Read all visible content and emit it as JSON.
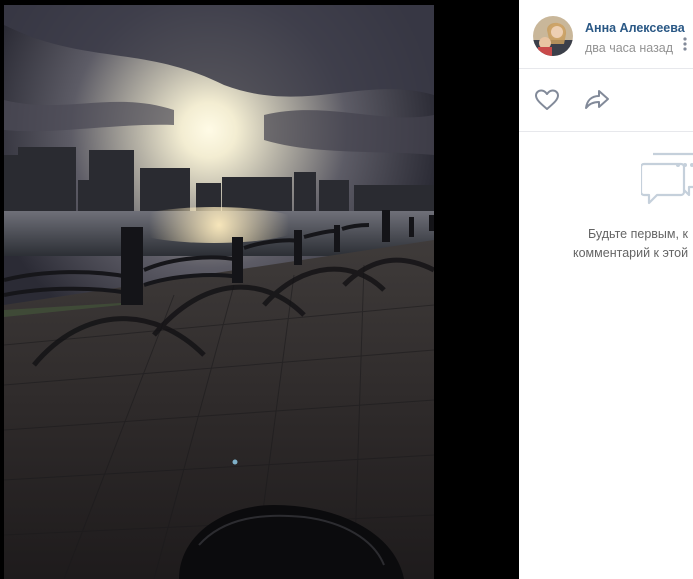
{
  "post": {
    "author_name": "Анна Алексеева",
    "time": "два часа назад"
  },
  "icons": {
    "avatar": "avatar",
    "more": "more-icon",
    "like": "heart-icon",
    "share": "share-icon",
    "comments": "comments-icon"
  },
  "comments": {
    "empty_line_1": "Будьте первым, к",
    "empty_line_2": "комментарий к этой"
  },
  "colors": {
    "name_link": "#2a5885",
    "time_text": "#939393",
    "icon_gray": "#828a99",
    "empty_text": "#656565",
    "divider": "#e7e8ec"
  }
}
